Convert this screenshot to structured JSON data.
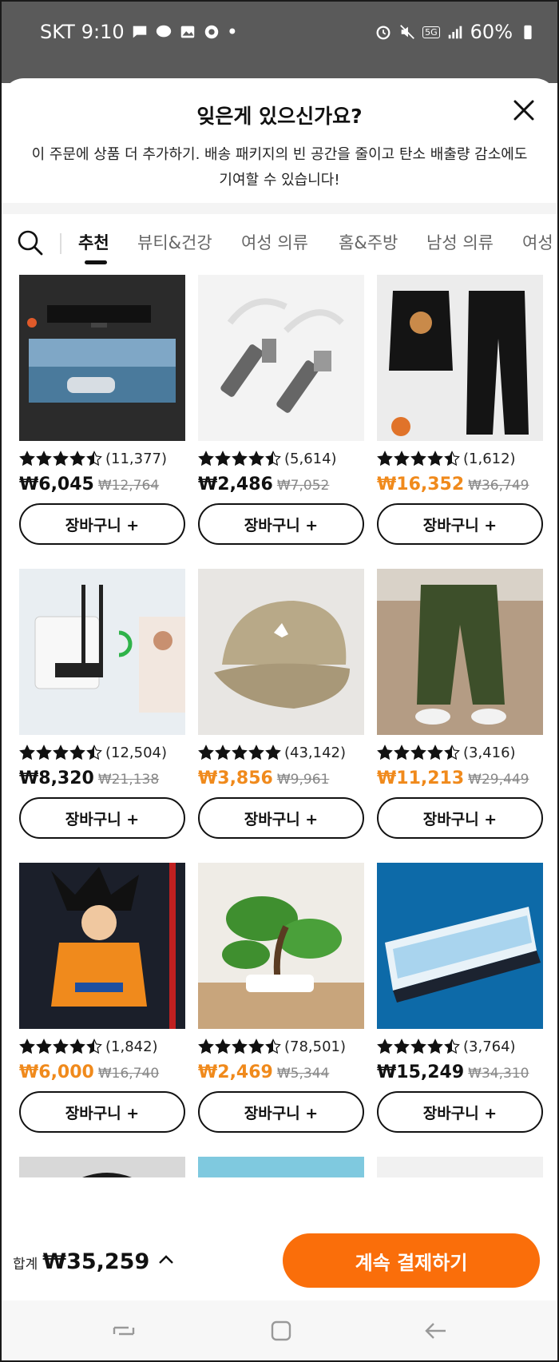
{
  "status_bar": {
    "carrier": "SKT",
    "time": "9:10",
    "network": "5G",
    "battery": "60%"
  },
  "sheet": {
    "title": "잊은게 있으신가요?",
    "description": "이 주문에 상품 더 추가하기. 배송 패키지의 빈 공간을 줄이고 탄소 배출량 감소에도 기여할 수 있습니다!"
  },
  "tabs": [
    {
      "label": "추천",
      "active": true
    },
    {
      "label": "뷰티&건강",
      "active": false
    },
    {
      "label": "여성 의류",
      "active": false
    },
    {
      "label": "홈&주방",
      "active": false
    },
    {
      "label": "남성 의류",
      "active": false
    },
    {
      "label": "여성",
      "active": false
    }
  ],
  "products": [
    {
      "rating": 4.5,
      "reviews": "(11,377)",
      "price": "₩6,045",
      "old_price": "₩12,764",
      "price_highlight": false,
      "cart_label": "장바구니 +",
      "image": "gaming-desk-mat"
    },
    {
      "rating": 4.5,
      "reviews": "(5,614)",
      "price": "₩2,486",
      "old_price": "₩7,052",
      "price_highlight": false,
      "cart_label": "장바구니 +",
      "image": "usb-hub"
    },
    {
      "rating": 4.5,
      "reviews": "(1,612)",
      "price": "₩16,352",
      "old_price": "₩36,749",
      "price_highlight": true,
      "cart_label": "장바구니 +",
      "image": "black-tracksuit"
    },
    {
      "rating": 4.5,
      "reviews": "(12,504)",
      "price": "₩8,320",
      "old_price": "₩21,138",
      "price_highlight": false,
      "cart_label": "장바구니 +",
      "image": "wifi-adapter"
    },
    {
      "rating": 5,
      "reviews": "(43,142)",
      "price": "₩3,856",
      "old_price": "₩9,961",
      "price_highlight": true,
      "cart_label": "장바구니 +",
      "image": "baseball-cap"
    },
    {
      "rating": 4.5,
      "reviews": "(3,416)",
      "price": "₩11,213",
      "old_price": "₩29,449",
      "price_highlight": true,
      "cart_label": "장바구니 +",
      "image": "jogger-pants"
    },
    {
      "rating": 4.5,
      "reviews": "(1,842)",
      "price": "₩6,000",
      "old_price": "₩16,740",
      "price_highlight": true,
      "cart_label": "장바구니 +",
      "image": "goku-figure"
    },
    {
      "rating": 4.5,
      "reviews": "(78,501)",
      "price": "₩2,469",
      "old_price": "₩5,344",
      "price_highlight": true,
      "cart_label": "장바구니 +",
      "image": "bonsai-tree"
    },
    {
      "rating": 4.5,
      "reviews": "(3,764)",
      "price": "₩15,249",
      "old_price": "₩34,310",
      "price_highlight": false,
      "cart_label": "장바구니 +",
      "image": "keyboard"
    },
    {
      "image": "slipper"
    },
    {
      "image": "charger"
    },
    {
      "image": "mouse"
    }
  ],
  "bottom_bar": {
    "total_label": "합계",
    "total_amount": "₩35,259",
    "checkout_label": "계속 결제하기"
  },
  "colors": {
    "accent_orange": "#fa6e0a",
    "highlight_price": "#f08a1c"
  }
}
